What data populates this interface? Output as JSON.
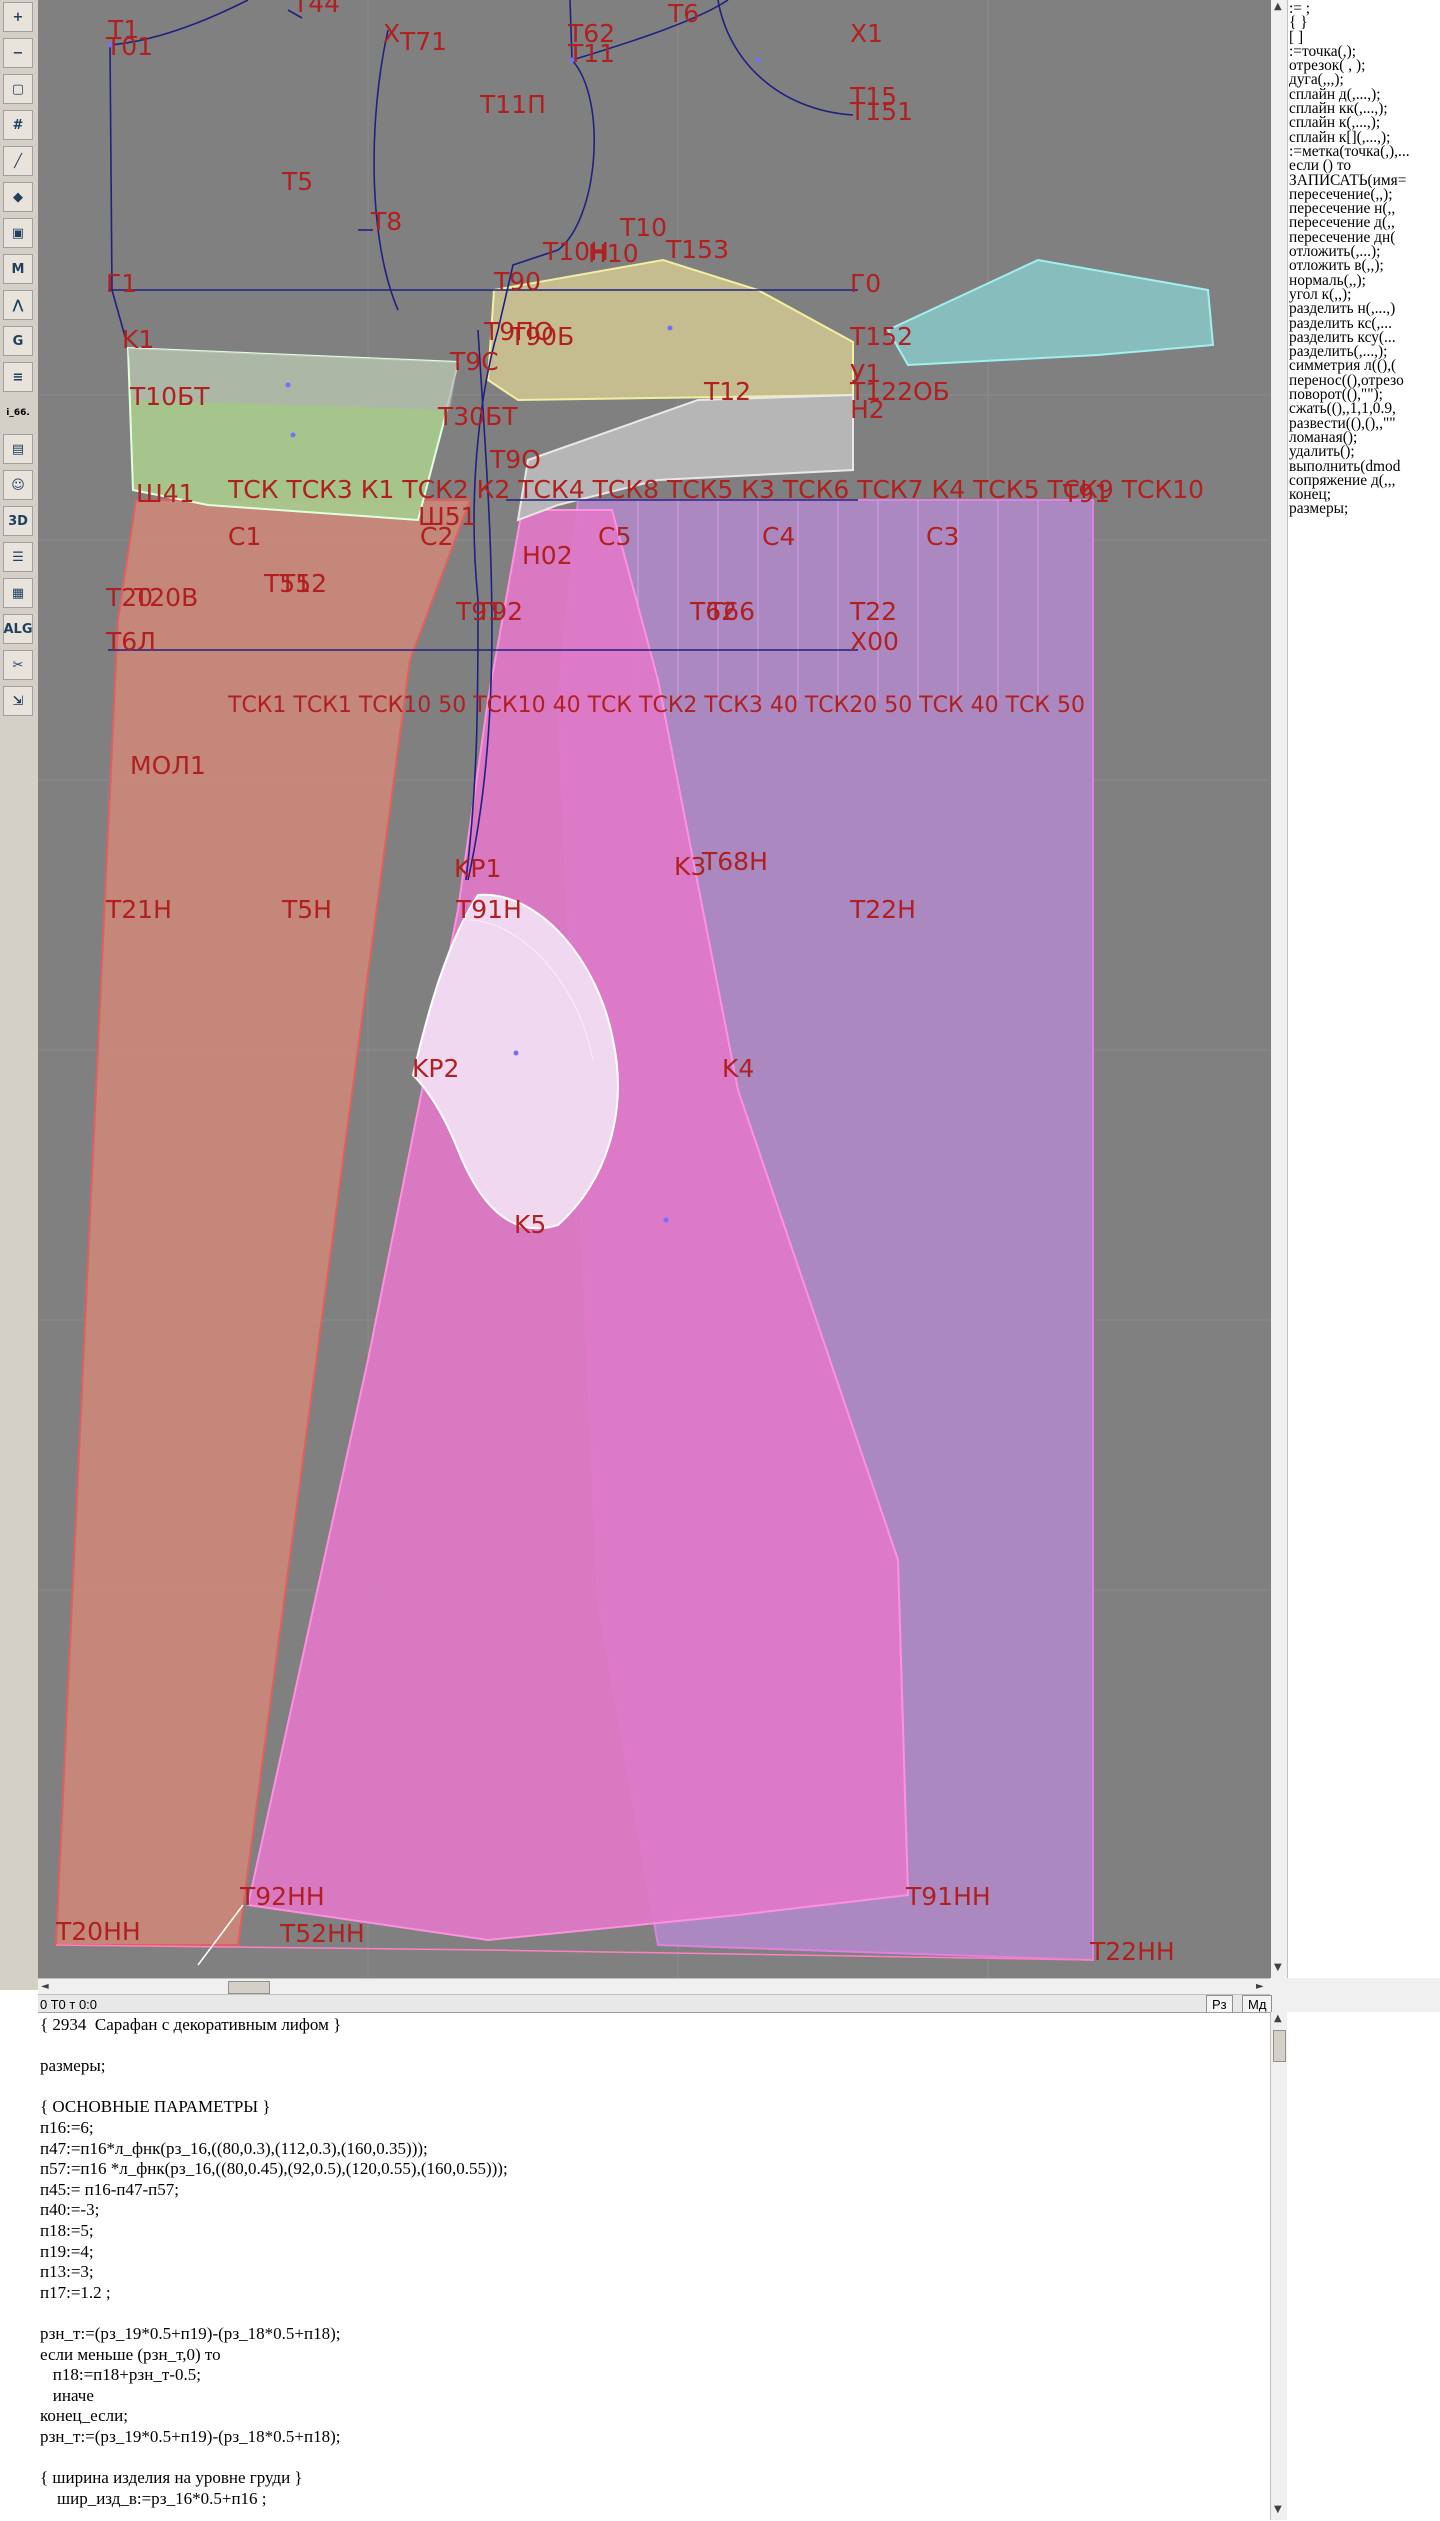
{
  "toolbar": {
    "tools": [
      {
        "name": "zoom-in-icon",
        "glyph": "+"
      },
      {
        "name": "zoom-out-icon",
        "glyph": "−"
      },
      {
        "name": "zoom-fit-icon",
        "glyph": "▢"
      },
      {
        "name": "grid-icon",
        "glyph": "#"
      },
      {
        "name": "line-tool-icon",
        "glyph": "╱"
      },
      {
        "name": "layer-icon",
        "glyph": "◆"
      },
      {
        "name": "pattern-piece-icon",
        "glyph": "▣"
      },
      {
        "name": "model-m-icon",
        "glyph": "M"
      },
      {
        "name": "compass-icon",
        "glyph": "⋀"
      },
      {
        "name": "model-g-icon",
        "glyph": "G"
      },
      {
        "name": "measure-icon",
        "glyph": "≡"
      },
      {
        "name": "label-size-text",
        "glyph": "i_66."
      },
      {
        "name": "document-icon",
        "glyph": "▤"
      },
      {
        "name": "mannequin-icon",
        "glyph": "☺"
      },
      {
        "name": "3d-view-icon",
        "glyph": "3D"
      },
      {
        "name": "list-icon",
        "glyph": "☰"
      },
      {
        "name": "print-icon",
        "glyph": "▦"
      },
      {
        "name": "algorithm-icon",
        "glyph": "ALG"
      },
      {
        "name": "cut-line-icon",
        "glyph": "✂"
      },
      {
        "name": "export-icon",
        "glyph": "⇲"
      }
    ]
  },
  "drawing": {
    "labels": {
      "t1": "T1",
      "t01": "T01",
      "t44": "T44",
      "x": "Х",
      "t71": "T71",
      "t62": "T62",
      "t11": "T11",
      "t6": "T6",
      "x1": "Х1",
      "t11p": "T11П",
      "t15": "T15",
      "t151": "T151",
      "t5": "T5",
      "t8": "T8",
      "t10": "T10",
      "t10n": "T10Н",
      "n10": "Н10",
      "t153": "T153",
      "g1": "Г1",
      "t90": "T90",
      "g0": "Г0",
      "t90p": "T9ПО",
      "t90b": "T90Б",
      "t152": "T152",
      "k1": "K1",
      "t9c": "T9C",
      "t10bt": "T10БТ",
      "t12": "T12",
      "y1": "У1",
      "t122ob": "T122ОБ",
      "t30bt": "T30БТ",
      "h2": "Н2",
      "t9ow": "T9Ο",
      "sh41": "Ш41",
      "tsk_row": "ТСК ТСК3 К1  ТСК2 К2  ТСК4 ТСК8 ТСК5 К3 ТСК6 ТСК7 К4 ТСК5 ТСК9 ТСК10",
      "t91row": "Т91",
      "sh51": "Ш51",
      "c1": "C1",
      "c2": "C2",
      "c5": "C5",
      "c4": "C4",
      "c3": "C3",
      "n02": "Н02",
      "t20": "T20",
      "t20v": "T20В",
      "t51": "T51",
      "t52": "T52",
      "t91": "T91",
      "t92": "T92",
      "t62b": "T62",
      "t66": "T66",
      "t22": "T22",
      "t6l": "T6Л",
      "x00": "Х00",
      "tsk_row2": "ТСК1 ТСК1 ТСК10 50 ТСК10 40 ТСК ТСК2 ТСК3 40 ТСК20 50 ТСК 40 ТСК 50",
      "mol1": "МОЛ1",
      "kr1": "KP1",
      "k3": "K3",
      "t68n": "T68Н",
      "t21n": "T21Н",
      "t5n": "T5Н",
      "t91n": "T91Н",
      "t22n": "T22Н",
      "kr2": "KP2",
      "k4": "K4",
      "k5": "K5",
      "t92nn": "T92НН",
      "t91nn": "T91НН",
      "t20nn": "T20НН",
      "t52nn": "T52НН",
      "t22nn": "T22НН"
    }
  },
  "commands": [
    ":= ;",
    "  {  }",
    "[  ]",
    ":=точка(,);",
    "отрезок( , );",
    "дуга(,,,);",
    "сплайн  д(,...,);",
    "сплайн  кк(,...,);",
    "сплайн  к(,...,);",
    "сплайн  к[](,...,);",
    ":=метка(точка(,),...",
    "если () то",
    "ЗАПИСАТЬ(имя=",
    "пересечение(,,);",
    "пересечение  н(,,",
    "пересечение  д(,,",
    "пересечение  дн(",
    "отложить(,...);",
    "отложить  в(,,);",
    "нормаль(,,);",
    "угол  к(,,);",
    "разделить  н(,...,)",
    "разделить  кс(,...",
    "разделить  ксу(...",
    "разделить(,...,);",
    "симметрия  л((),(",
    "перенос((),отрезо",
    "поворот((),\"\");",
    "сжать((),,1,1,0.9,",
    "развести((),(),,\"\"",
    "ломаная();",
    "удалить();",
    "выполнить(dmod",
    "сопряжение  д(,,,",
    "конец;",
    "размеры;"
  ],
  "status": {
    "coords": "0  T0 т 0:0",
    "btn_rz": "Рз",
    "btn_md": "Мд"
  },
  "code_lines": [
    "{ 2934  Сарафан с декоративным лифом }",
    "",
    "размеры;",
    "",
    "{ ОСНОВНЫЕ ПАРАМЕТРЫ }",
    "п16:=6;",
    "п47:=п16*л_фнк(рз_16,((80,0.3),(112,0.3),(160,0.35)));",
    "п57:=п16 *л_фнк(рз_16,((80,0.45),(92,0.5),(120,0.55),(160,0.55)));",
    "п45:= п16-п47-п57;",
    "п40:=-3;",
    "п18:=5;",
    "п19:=4;",
    "п13:=3;",
    "п17:=1.2 ;",
    "",
    "рзн_т:=(рз_19*0.5+п19)-(рз_18*0.5+п18);",
    "если меньше (рзн_т,0) то",
    "   п18:=п18+рзн_т-0.5;",
    "   иначе",
    "конец_если;",
    "рзн_т:=(рз_19*0.5+п19)-(рз_18*0.5+п18);",
    "",
    "{ ширина изделия на уровне груди }",
    "    шир_изд_в:=рз_16*0.5+п16 ;"
  ],
  "colors": {
    "canvas": "#808080",
    "pink_piece": "#e078c8",
    "purple_piece": "#b088c8",
    "salmon_piece": "#d08878",
    "green_piece": "#a8c88c",
    "yellow_piece": "#c8c090",
    "cyan_piece": "#88c0c0",
    "label": "#b02020",
    "construction_line": "#202080"
  }
}
